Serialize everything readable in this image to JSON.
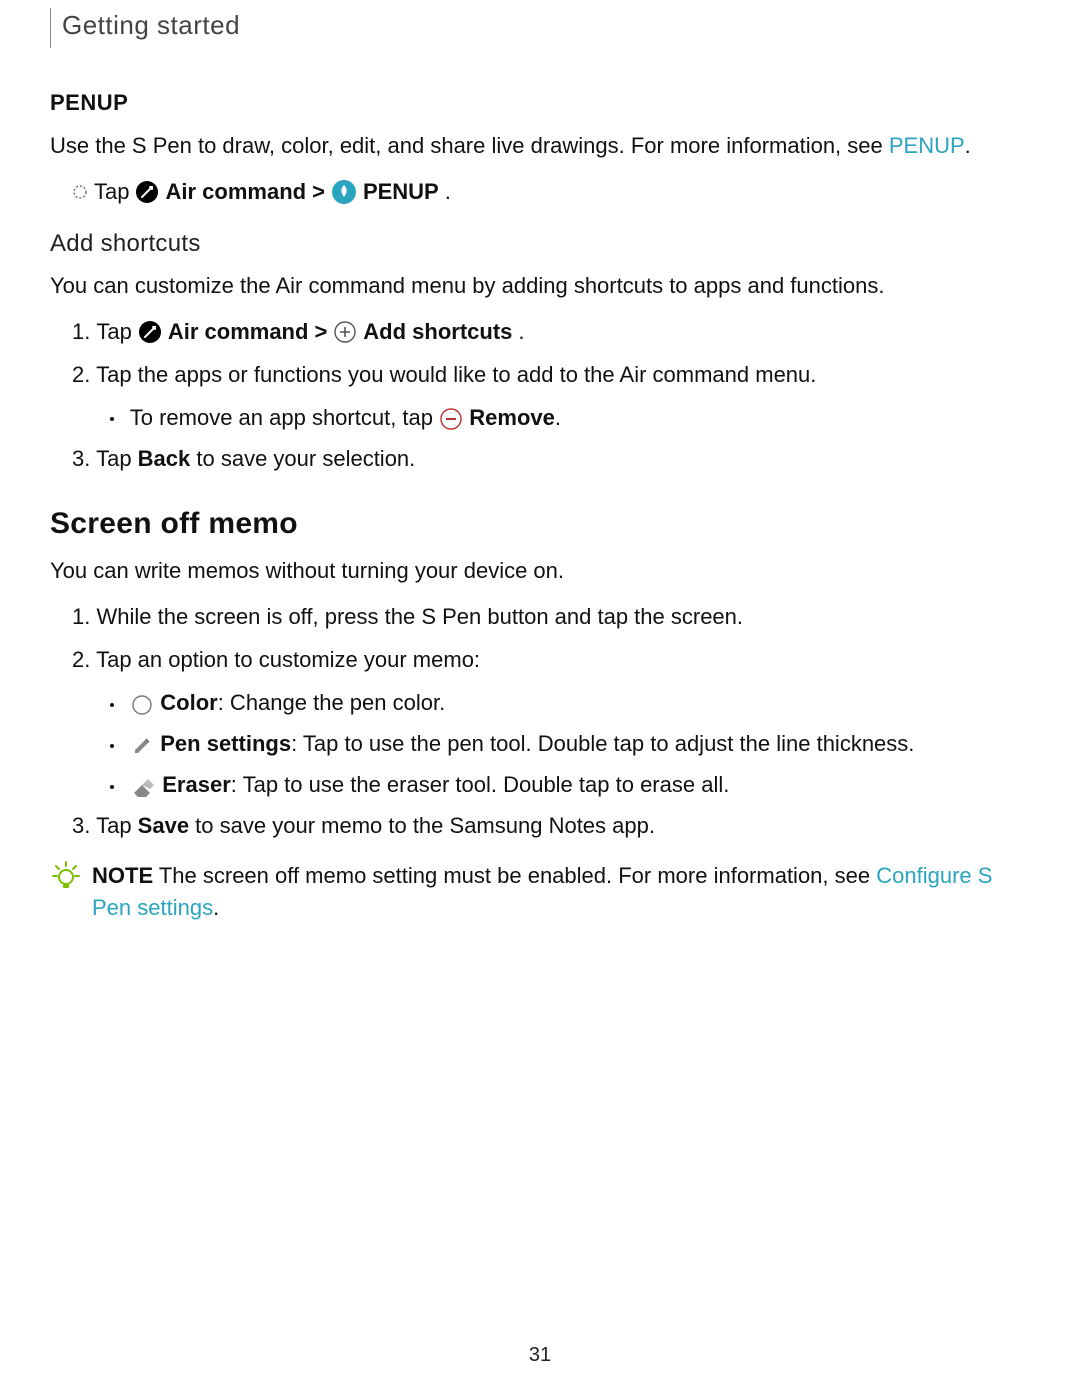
{
  "header": "Getting started",
  "page_number": "31",
  "colors": {
    "link": "#2aa4bf",
    "note_icon": "#7ac100"
  },
  "penup": {
    "title": "PENUP",
    "desc_before_link": "Use the S Pen to draw, color, edit, and share live drawings. For more information, see ",
    "link": "PENUP",
    "desc_after_link": ".",
    "step_tap": "Tap",
    "air_command": "Air command",
    "sep": ">",
    "penup_label": "PENUP",
    "tail": "."
  },
  "addshortcuts": {
    "title": "Add shortcuts",
    "desc": "You can customize the Air command menu by adding shortcuts to apps and functions.",
    "step1_num": "1.",
    "step1_tap": "Tap",
    "step1_air": "Air command",
    "step1_sep": ">",
    "step1_add": "Add shortcuts",
    "step1_tail": ".",
    "step2_num": "2.",
    "step2_text": "Tap the apps or functions you would like to add to the Air command menu.",
    "step2_sub_prefix": "To remove an app shortcut, tap",
    "step2_sub_bold": "Remove",
    "step2_sub_tail": ".",
    "step3_num": "3.",
    "step3_tap": "Tap ",
    "step3_back": "Back",
    "step3_rest": " to save your selection."
  },
  "screenoff": {
    "title": "Screen off memo",
    "desc": "You can write memos without turning your device on.",
    "s1_num": "1.",
    "s1_text": "While the screen is off, press the S Pen button and tap the screen.",
    "s2_num": "2.",
    "s2_text": "Tap an option to customize your memo:",
    "s2a_bold": "Color",
    "s2a_rest": ": Change the pen color.",
    "s2b_bold": "Pen settings",
    "s2b_rest": ": Tap to use the pen tool. Double tap to adjust the line thickness.",
    "s2c_bold": "Eraser",
    "s2c_rest": ": Tap to use the eraser tool. Double tap to erase all.",
    "s3_num": "3.",
    "s3_tap": "Tap ",
    "s3_save": "Save",
    "s3_rest": " to save your memo to the Samsung Notes app.",
    "note_label": "NOTE",
    "note_text_before": "  The screen off memo setting must be enabled. For more information, see ",
    "note_link": "Configure S Pen settings",
    "note_tail": "."
  }
}
